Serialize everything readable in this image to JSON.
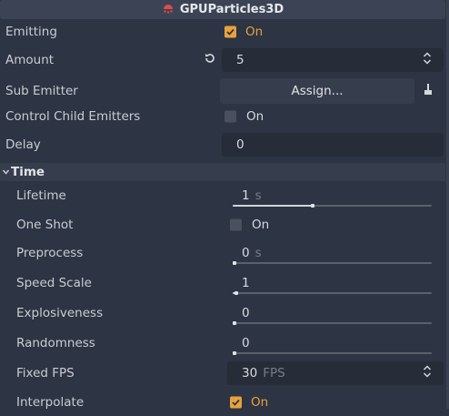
{
  "header": {
    "title": "GPUParticles3D",
    "icon": "particles-icon",
    "icon_color": "#e04b4b"
  },
  "accent": "#e8a23b",
  "properties": {
    "emitting": {
      "label": "Emitting",
      "checked": true,
      "value": "On"
    },
    "amount": {
      "label": "Amount",
      "value": "5"
    },
    "sub_emitter": {
      "label": "Sub Emitter",
      "button": "Assign..."
    },
    "control_child_emitters": {
      "label": "Control Child Emitters",
      "checked": false,
      "value": "On"
    },
    "delay": {
      "label": "Delay",
      "value": "0"
    }
  },
  "time_section": {
    "title": "Time",
    "lifetime": {
      "label": "Lifetime",
      "value": "1",
      "unit": "s",
      "fill": 0.4
    },
    "one_shot": {
      "label": "One Shot",
      "checked": false,
      "value": "On"
    },
    "preprocess": {
      "label": "Preprocess",
      "value": "0",
      "unit": "s",
      "fill": 0.0
    },
    "speed_scale": {
      "label": "Speed Scale",
      "value": "1",
      "fill": 0.02
    },
    "explosiveness": {
      "label": "Explosiveness",
      "value": "0",
      "fill": 0.0
    },
    "randomness": {
      "label": "Randomness",
      "value": "0",
      "fill": 0.0
    },
    "fixed_fps": {
      "label": "Fixed FPS",
      "value": "30",
      "unit": "FPS"
    },
    "interpolate": {
      "label": "Interpolate",
      "checked": true,
      "value": "On"
    }
  }
}
